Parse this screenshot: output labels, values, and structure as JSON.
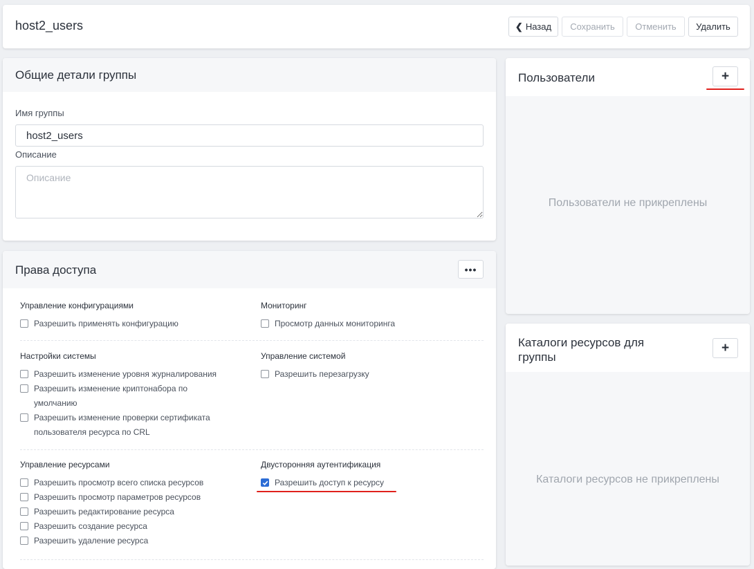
{
  "header": {
    "title": "host2_users",
    "back_label": "Назад",
    "save_label": "Сохранить",
    "cancel_label": "Отменить",
    "delete_label": "Удалить"
  },
  "general": {
    "title": "Общие детали группы",
    "name_label": "Имя группы",
    "name_value": "host2_users",
    "description_label": "Описание",
    "description_placeholder": "Описание"
  },
  "permissions": {
    "title": "Права доступа",
    "more_icon": "ellipsis-icon",
    "groups": [
      {
        "title": "Управление конфигурациями",
        "items": [
          {
            "label": "Разрешить применять конфигурацию",
            "checked": false
          }
        ]
      },
      {
        "title": "Мониторинг",
        "items": [
          {
            "label": "Просмотр данных мониторинга",
            "checked": false
          }
        ]
      },
      {
        "title": "Настройки системы",
        "items": [
          {
            "label": "Разрешить изменение уровня журналирования",
            "checked": false
          },
          {
            "label": "Разрешить изменение криптонабора по умолчанию",
            "checked": false
          },
          {
            "label": "Разрешить изменение проверки сертификата пользователя ресурса по CRL",
            "checked": false
          }
        ]
      },
      {
        "title": "Управление системой",
        "items": [
          {
            "label": "Разрешить перезагрузку",
            "checked": false
          }
        ]
      },
      {
        "title": "Управление ресурсами",
        "items": [
          {
            "label": "Разрешить просмотр всего списка ресурсов",
            "checked": false
          },
          {
            "label": "Разрешить просмотр параметров ресурсов",
            "checked": false
          },
          {
            "label": "Разрешить редактирование ресурса",
            "checked": false
          },
          {
            "label": "Разрешить создание ресурса",
            "checked": false
          },
          {
            "label": "Разрешить удаление ресурса",
            "checked": false
          }
        ]
      },
      {
        "title": "Двусторонняя аутентификация",
        "items": [
          {
            "label": "Разрешить доступ к ресурсу",
            "checked": true
          }
        ]
      }
    ]
  },
  "users": {
    "title": "Пользователи",
    "add_label": "+",
    "empty_message": "Пользователи не прикреплены"
  },
  "catalogs": {
    "title": "Каталоги ресурсов для группы",
    "add_label": "+",
    "empty_message": "Каталоги ресурсов не прикреплены"
  },
  "colors": {
    "accent": "#2c6cd5",
    "highlight": "#e0201c",
    "background": "#eef0f3"
  }
}
